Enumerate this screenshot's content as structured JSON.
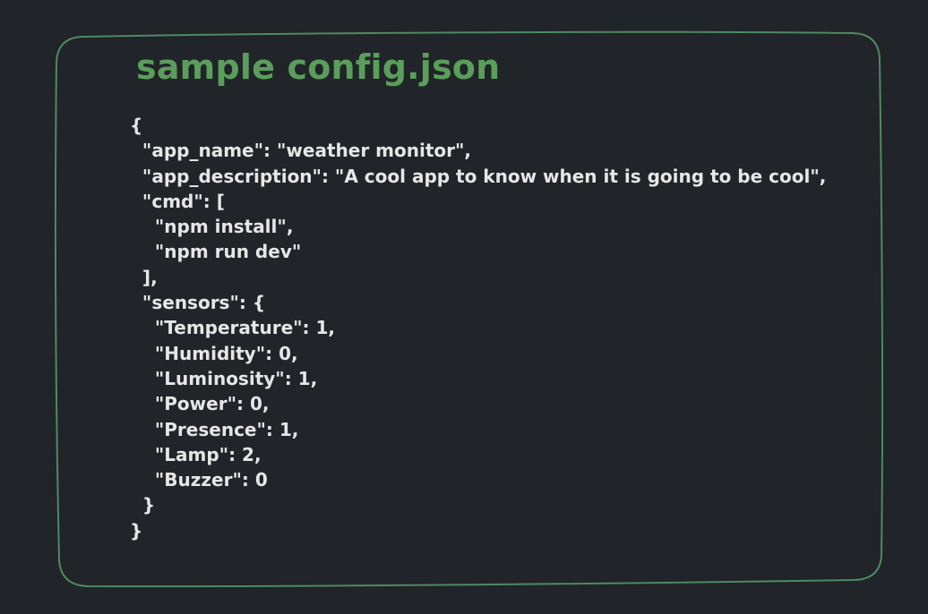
{
  "title": "sample config.json",
  "colors": {
    "background": "#212428",
    "accent": "#5a9e5b",
    "border": "#4e8a63",
    "text": "#e6e6e6"
  },
  "code_lines": [
    "{",
    "  \"app_name\": \"weather monitor\",",
    "  \"app_description\": \"A cool app to know when it is going to be cool\",",
    "  \"cmd\": [",
    "    \"npm install\",",
    "    \"npm run dev\"",
    "  ],",
    "  \"sensors\": {",
    "    \"Temperature\": 1,",
    "    \"Humidity\": 0,",
    "    \"Luminosity\": 1,",
    "    \"Power\": 0,",
    "    \"Presence\": 1,",
    "    \"Lamp\": 2,",
    "    \"Buzzer\": 0",
    "  }",
    "}"
  ]
}
